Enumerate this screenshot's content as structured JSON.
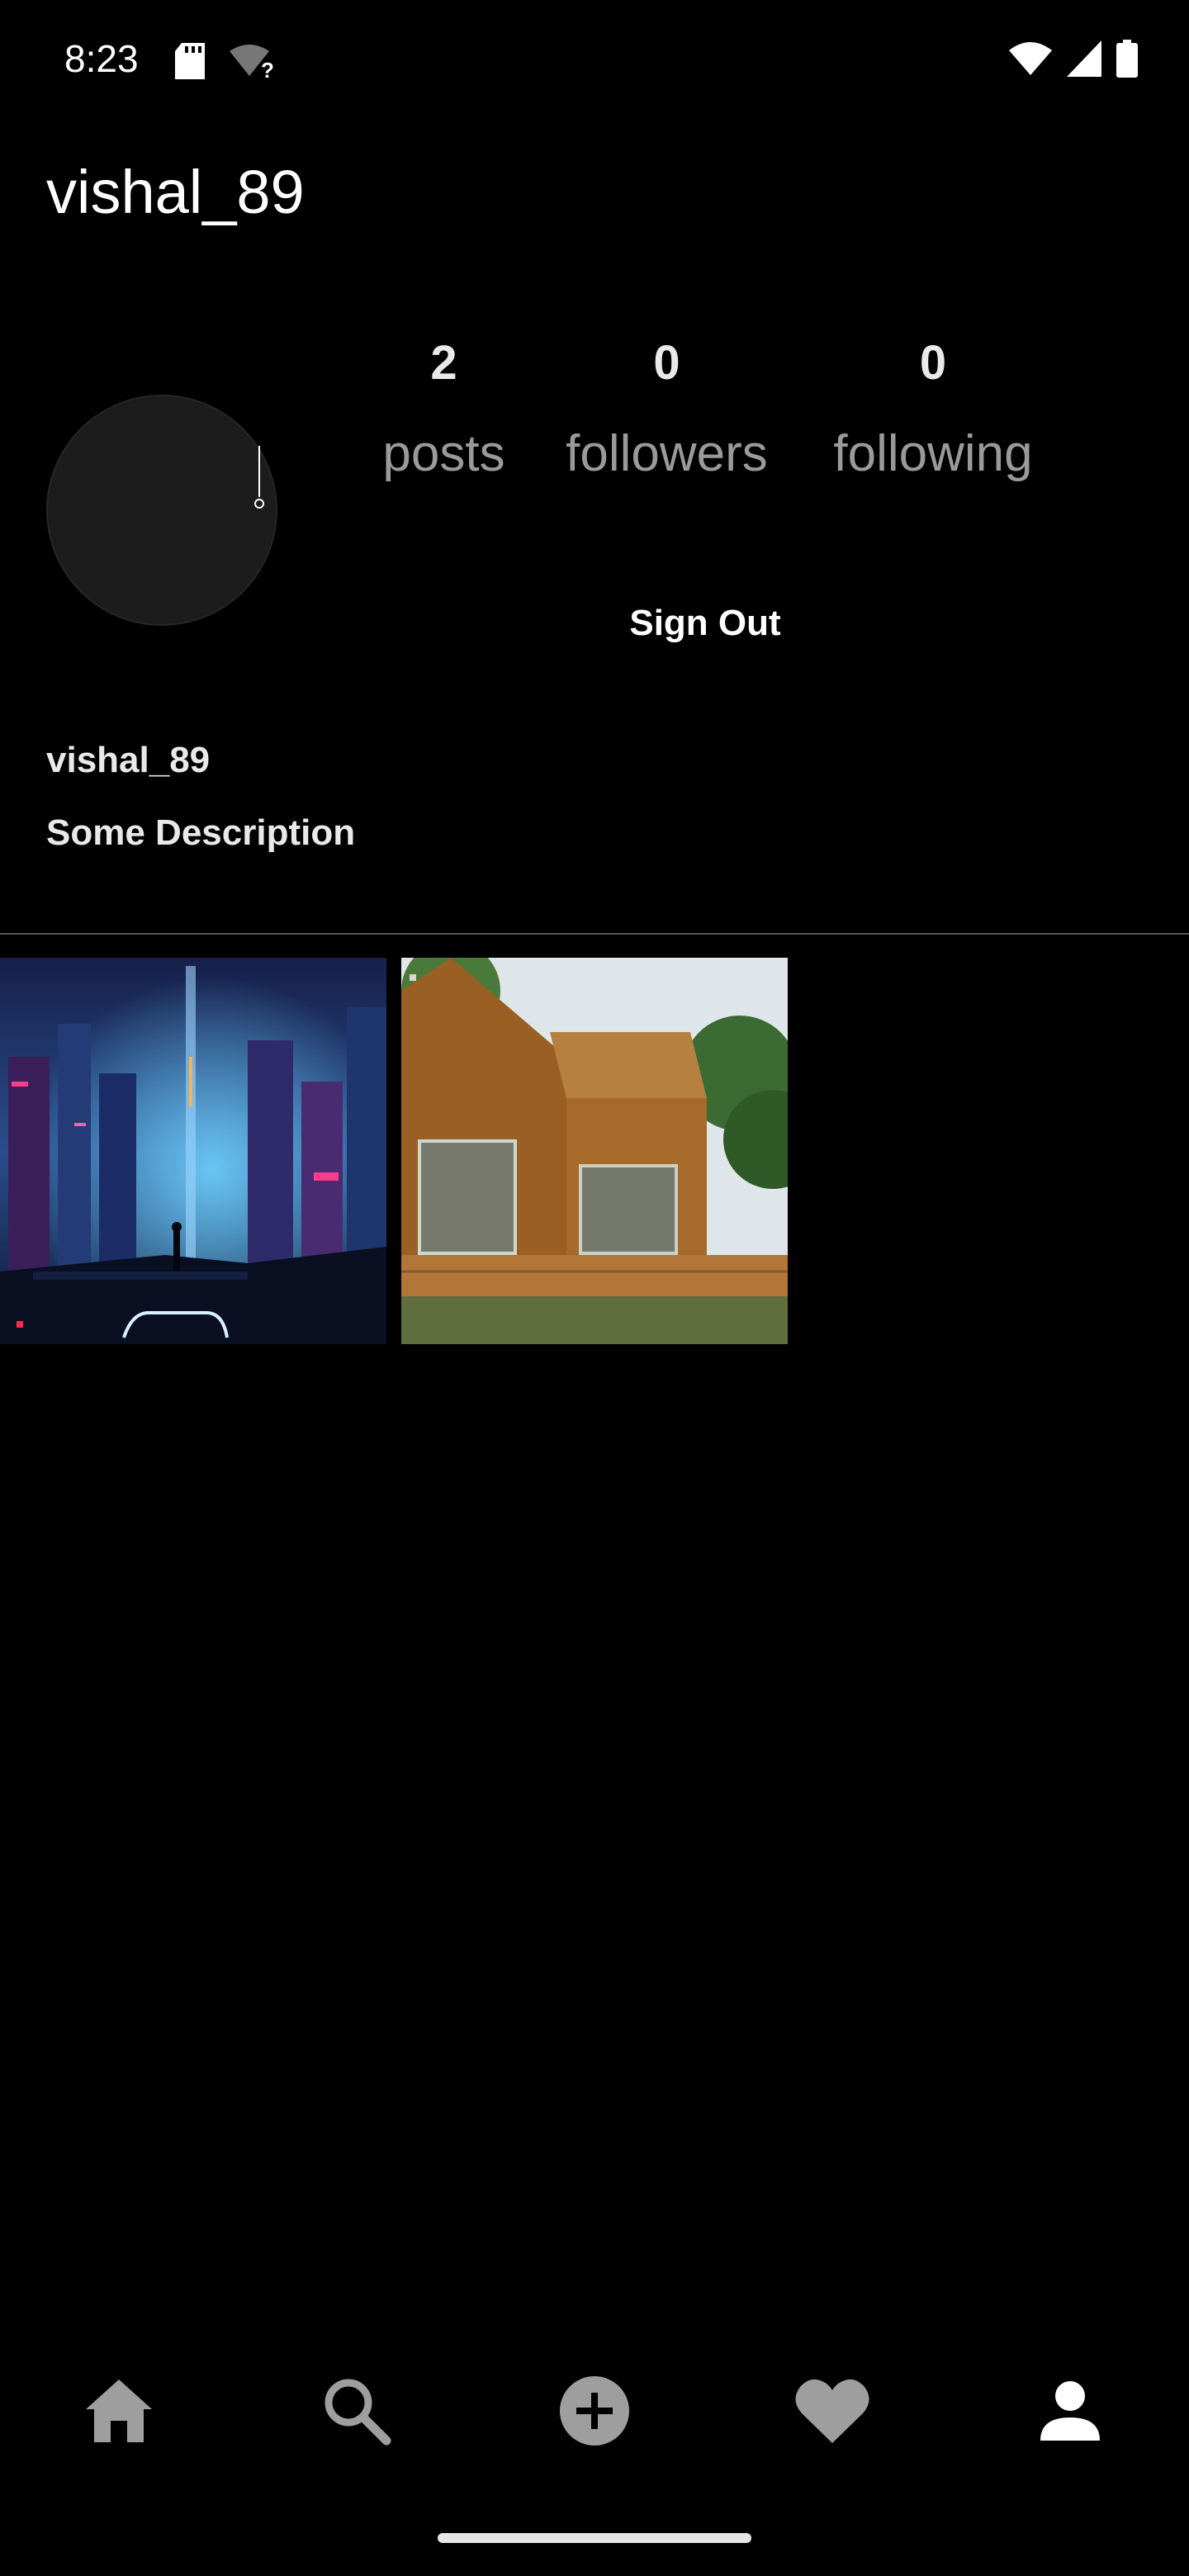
{
  "status_bar": {
    "time": "8:23",
    "icons": [
      "sd-card-icon",
      "wifi-unknown-icon",
      "wifi-icon",
      "cell-signal-icon",
      "battery-icon"
    ]
  },
  "header": {
    "username": "vishal_89"
  },
  "stats": {
    "posts": {
      "value": "2",
      "label": "posts"
    },
    "followers": {
      "value": "0",
      "label": "followers"
    },
    "following": {
      "value": "0",
      "label": "following"
    }
  },
  "actions": {
    "sign_out_label": "Sign Out"
  },
  "profile": {
    "name": "vishal_89",
    "description": "Some Description"
  },
  "posts": [
    {
      "alt": "cyberpunk city"
    },
    {
      "alt": "wooden house"
    }
  ],
  "bottom_nav": {
    "items": [
      "home-icon",
      "search-icon",
      "add-post-icon",
      "activity-heart-icon",
      "profile-icon"
    ],
    "active": "profile-icon"
  },
  "colors": {
    "background": "#000000",
    "text_primary": "#ffffff",
    "text_secondary": "#9a9a9a",
    "nav_inactive": "#9e9e9e"
  }
}
